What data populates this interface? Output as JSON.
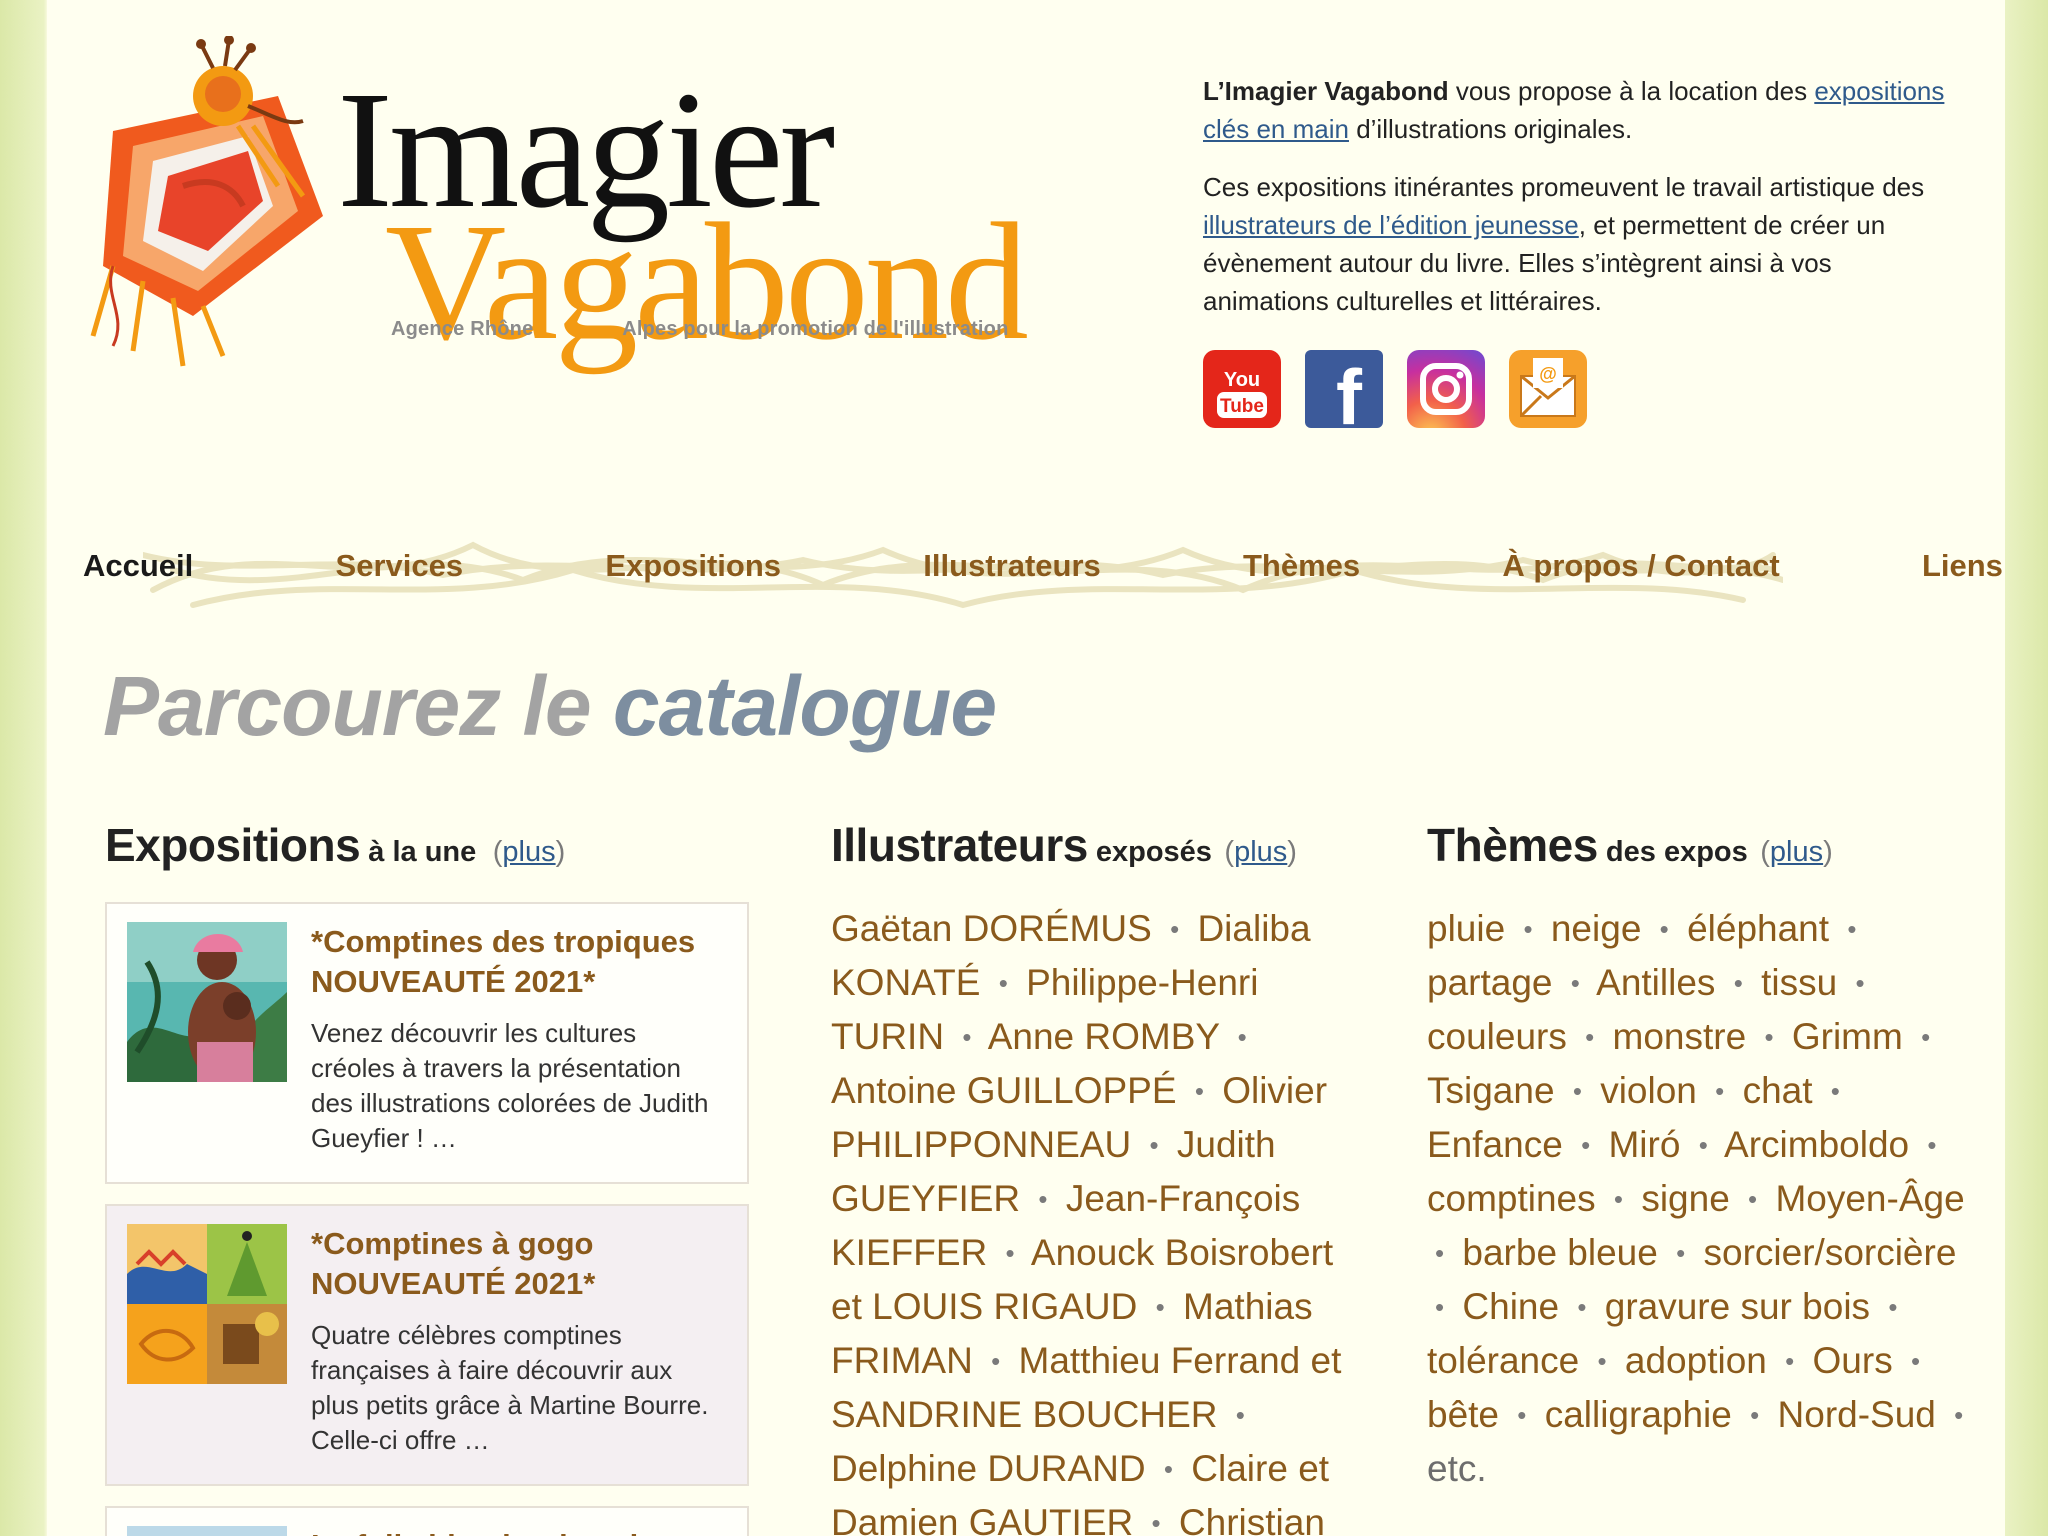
{
  "logo": {
    "title_line1": "Imagier",
    "title_line2": "Vagabond",
    "subtitle_left": "Agence Rhône",
    "subtitle_right": "Alpes pour la promotion de l'illustration"
  },
  "intro": {
    "p1_strong": "L’Imagier Vagabond",
    "p1_text": " vous propose à la location des ",
    "p1_link": "expositions clés en main",
    "p1_end": " d’illustrations originales.",
    "p2_start": "Ces expositions itinérantes promeuvent le travail artistique des ",
    "p2_link": "illustrateurs de l’édition jeunesse",
    "p2_end": ", et permettent de créer un évènement autour du livre. Elles s’intègrent ainsi à vos animations culturelles et littéraires."
  },
  "social": {
    "youtube_line1": "You",
    "youtube_line2": "Tube",
    "facebook_glyph": "f",
    "mail_glyph": "@"
  },
  "nav": {
    "items": [
      "Accueil",
      "Services",
      "Expositions",
      "Illustrateurs",
      "Thèmes",
      "À propos / Contact",
      "Liens"
    ]
  },
  "catalogue": {
    "title_part1": "Parcourez le ",
    "title_part2": "catalogue"
  },
  "expositions": {
    "heading_big": "Exposition",
    "heading_big_s": "s",
    "heading_small": " à la une",
    "paren_open": "(",
    "more": "plus",
    "paren_close": ")",
    "cards": [
      {
        "title": "*Comptines des tropiques NOUVEAUTÉ 2021*",
        "text": "Venez découvrir les cultures créoles à travers la présentation des illustrations colorées de Judith Gueyfier ! …"
      },
      {
        "title": "*Comptines à gogo NOUVEAUTÉ 2021*",
        "text": "Quatre célèbres comptines françaises à faire découvrir aux plus petits grâce à Martine Bourre. Celle-ci offre …"
      },
      {
        "title": "La folle histoire des plantes",
        "text": ""
      }
    ]
  },
  "illustrateurs": {
    "heading_big": "Illustrateurs",
    "heading_small": " exposés",
    "paren_open": "(",
    "more": "plus",
    "paren_close": ")",
    "items": [
      "Gaëtan DORÉMUS",
      "Dialiba KONATÉ",
      "Philippe-Henri TURIN",
      "Anne ROMBY",
      "Antoine GUILLOPPÉ",
      "Olivier PHILIPPONNEAU",
      "Judith GUEYFIER",
      "Jean-François KIEFFER",
      "Anouck Boisrobert et LOUIS RIGAUD",
      "Mathias FRIMAN",
      "Matthieu Ferrand et SANDRINE BOUCHER",
      "Delphine DURAND",
      "Claire et Damien GAUTIER",
      "Christian"
    ]
  },
  "themes": {
    "heading_big": "Thèmes",
    "heading_small": " des expos",
    "paren_open": "(",
    "more": "plus",
    "paren_close": ")",
    "items": [
      "pluie",
      "neige",
      "éléphant",
      "partage",
      "Antilles",
      "tissu",
      "couleurs",
      "monstre",
      "Grimm",
      "Tsigane",
      "violon",
      "chat",
      "Enfance",
      "Miró",
      "Arcimboldo",
      "comptines",
      "signe",
      "Moyen-Âge",
      "barbe bleue",
      "sorcier/sorcière",
      "Chine",
      "gravure sur bois",
      "tolérance",
      "adoption",
      "Ours",
      "bête",
      "calligraphie",
      "Nord-Sud"
    ],
    "etc": "etc."
  },
  "separator": "•",
  "colors": {
    "brand_orange": "#f39a12",
    "link_brown": "#8a5a1c",
    "link_blue": "#2f5a8b",
    "catalogue_grey": "#a3a3a3",
    "catalogue_accent": "#7d8ea0"
  }
}
